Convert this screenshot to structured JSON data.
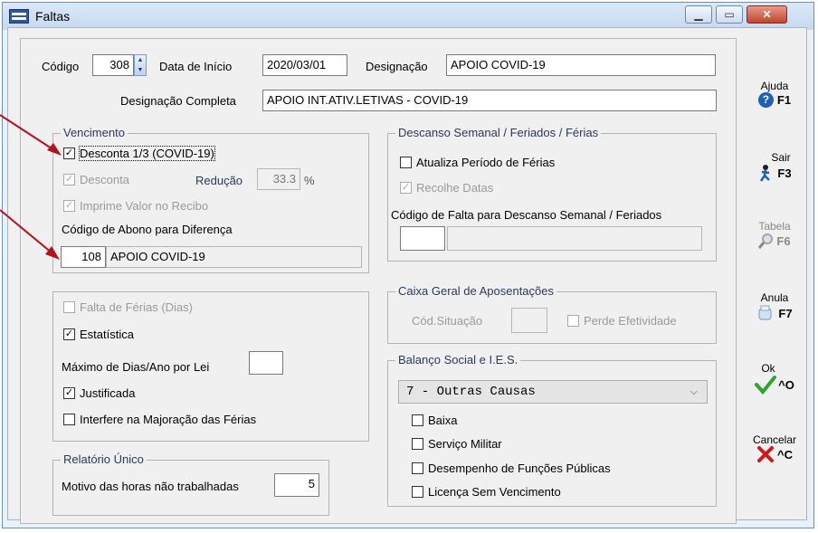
{
  "window": {
    "title": "Faltas",
    "minimize_label": "▭",
    "maximize_label": "▭",
    "close_label": "✕"
  },
  "header": {
    "codigo_label": "Código",
    "codigo_value": "308",
    "data_inicio_label": "Data de Início",
    "data_inicio_value": "2020/03/01",
    "designacao_label": "Designação",
    "designacao_value": "APOIO COVID-19",
    "designacao_completa_label": "Designação Completa",
    "designacao_completa_value": "APOIO INT.ATIV.LETIVAS - COVID-19"
  },
  "vencimento": {
    "legend": "Vencimento",
    "desconta_covid_label": "Desconta 1/3 (COVID-19)",
    "desconta_covid_checked": true,
    "desconta_label": "Desconta",
    "desconta_checked": true,
    "reducao_label": "Redução",
    "reducao_value": "33.3",
    "reducao_unit": "%",
    "imprime_label": "Imprime Valor no Recibo",
    "imprime_checked": true,
    "codigo_abono_label": "Código de Abono para Diferença",
    "abono_code": "108",
    "abono_desc": "APOIO COVID-19"
  },
  "opcoes": {
    "falta_ferias_label": "Falta de Férias (Dias)",
    "falta_ferias_checked": false,
    "estatistica_label": "Estatística",
    "estatistica_checked": true,
    "maximo_dias_label": "Máximo de Dias/Ano por Lei",
    "maximo_dias_value": "",
    "justificada_label": "Justificada",
    "justificada_checked": true,
    "interfere_label": "Interfere na Majoração das Férias",
    "interfere_checked": false
  },
  "relatorio": {
    "legend": "Relatório Único",
    "motivo_label": "Motivo das horas não trabalhadas",
    "motivo_value": "5"
  },
  "descanso": {
    "legend": "Descanso Semanal / Feriados / Férias",
    "atualiza_label": "Atualiza Período de Férias",
    "atualiza_checked": false,
    "recolhe_label": "Recolhe Datas",
    "recolhe_checked": true,
    "codigo_falta_label": "Código de Falta para Descanso Semanal / Feriados",
    "codigo_value": "",
    "descricao_value": ""
  },
  "cga": {
    "legend": "Caixa Geral de Aposentações",
    "cod_situacao_label": "Cód.Situação",
    "cod_situacao_value": "",
    "perde_label": "Perde Efetividade",
    "perde_checked": false
  },
  "balanco": {
    "legend": "Balanço Social e I.E.S.",
    "select_value": "7 - Outras Causas",
    "baixa_label": "Baixa",
    "servico_label": "Serviço Militar",
    "desempenho_label": "Desempenho de Funções Públicas",
    "licenca_label": "Licença Sem Vencimento"
  },
  "side_buttons": {
    "ajuda_label": "Ajuda",
    "ajuda_key": "F1",
    "sair_label": "Sair",
    "sair_key": "F3",
    "tabela_label": "Tabela",
    "tabela_key": "F6",
    "anula_label": "Anula",
    "anula_key": "F7",
    "ok_label": "Ok",
    "ok_key": "^O",
    "cancelar_label": "Cancelar",
    "cancelar_key": "^C"
  },
  "colors": {
    "annotation_arrow": "#b3121c",
    "ok_check": "#2fa52f",
    "cancel_x": "#d01818",
    "help_blue": "#1f5fb8"
  }
}
